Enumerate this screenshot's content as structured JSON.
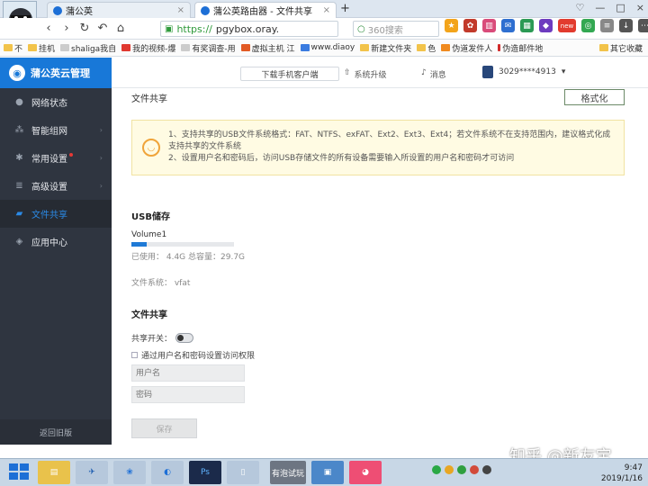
{
  "browser": {
    "tabs": [
      {
        "label": "蒲公英"
      },
      {
        "label": "蒲公英路由器 - 文件共享"
      }
    ],
    "close_glyph": "×",
    "new_tab": "+",
    "window_controls": [
      "♡",
      "—",
      "□",
      "×"
    ],
    "url_scheme": "https://",
    "url_rest": "pgybox.oray.",
    "search_placeholder": "360搜索",
    "bookmarks": [
      "不",
      "挂机",
      "shaliga我自",
      "我的视频-爆",
      "有奖调查-用",
      "虚拟主机 江",
      "www.diaoy",
      "新建文件夹",
      "色",
      "伪道发件人",
      "伪造邮件地",
      "其它收藏"
    ],
    "new_badge": "new"
  },
  "app": {
    "brand": "蒲公英云管理",
    "download_btn": "下载手机客户端",
    "upgrade": "系统升级",
    "messages": "消息",
    "user": "3029****4913",
    "sidebar": {
      "items": [
        {
          "label": "网络状态",
          "icon": "globe-icon"
        },
        {
          "label": "智能组网",
          "icon": "network-icon"
        },
        {
          "label": "常用设置",
          "icon": "gear-icon"
        },
        {
          "label": "高级设置",
          "icon": "layers-icon"
        },
        {
          "label": "文件共享",
          "icon": "folder-icon"
        },
        {
          "label": "应用中心",
          "icon": "apps-icon"
        }
      ],
      "old_version": "返回旧版"
    },
    "page": {
      "title": "文件共享",
      "format_btn": "格式化",
      "notice_line1": "1、支持共享的USB文件系统格式：FAT、NTFS、exFAT、Ext2、Ext3、Ext4；若文件系统不在支持范围内，建议格式化成支持共享的文件系统",
      "notice_line2": "2、设置用户名和密码后，访问USB存储文件的所有设备需要输入所设置的用户名和密码才可访问",
      "usb_title": "USB储存",
      "volume_name": "Volume1",
      "used_fraction": 0.15,
      "usage_text": "已使用： 4.4G   总容量：29.7G",
      "fs_text": "文件系统： vfat",
      "share_title": "文件共享",
      "share_switch_label": "共享开关：",
      "auth_label": "通过用户名和密码设置访问权限",
      "username_placeholder": "用户名",
      "password_placeholder": "密码",
      "save_btn": "保存"
    }
  },
  "watermark": {
    "text": "知乎 @新友宝"
  },
  "taskbar": {
    "pinned_label": "有泡试玩",
    "time": "9:47",
    "date": "2019/1/16"
  },
  "colors": {
    "brand_blue": "#1878d8",
    "sidebar_bg": "#2f3540",
    "notice_bg": "#fffbe3"
  }
}
